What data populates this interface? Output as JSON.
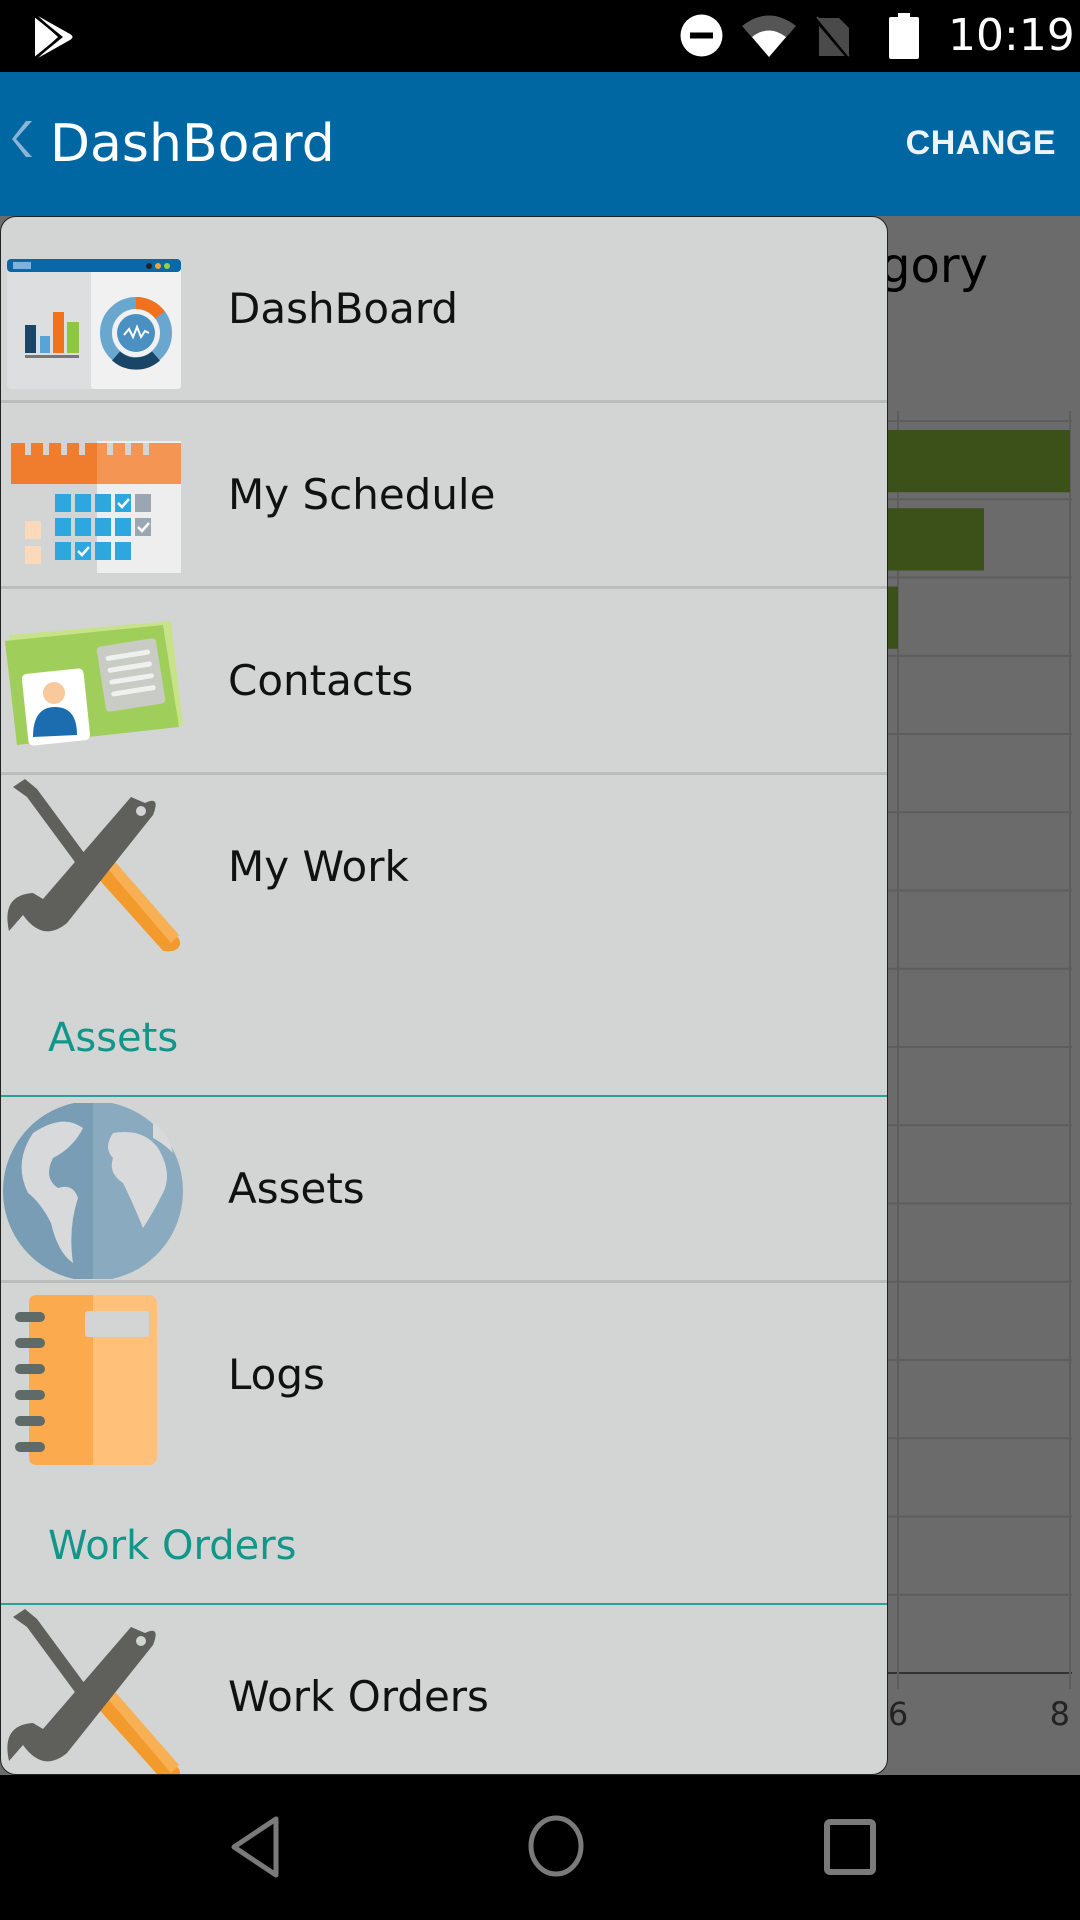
{
  "status_bar": {
    "time": "10:19",
    "icons": [
      "play-store-icon",
      "do-not-disturb-icon",
      "wifi-icon",
      "no-sim-icon",
      "battery-icon"
    ]
  },
  "app_bar": {
    "back_icon": "chevron-left-icon",
    "title": "DashBoard",
    "action_label": "CHANGE",
    "background_color": "#0167a3"
  },
  "background_content": {
    "title_visible_fragment": "gory",
    "chart_data": {
      "type": "bar",
      "orientation": "horizontal",
      "title": "gory",
      "series": [
        {
          "name": "",
          "values": [
            8,
            7,
            6
          ],
          "color": "#44552a"
        }
      ],
      "categories": [
        "",
        "",
        ""
      ],
      "visible_x_ticks": [
        "6",
        "8"
      ],
      "xlim": [
        6,
        8
      ],
      "grid": true,
      "row_count": 16
    }
  },
  "drawer": {
    "background_color": "#d3d5d5",
    "section_color": "#12968a",
    "groups": [
      {
        "header": null,
        "items": [
          {
            "label": "DashBoard",
            "icon": "dashboard-icon"
          },
          {
            "label": "My Schedule",
            "icon": "calendar-icon"
          },
          {
            "label": "Contacts",
            "icon": "contact-card-icon"
          },
          {
            "label": "My Work",
            "icon": "wrench-screwdriver-icon"
          }
        ]
      },
      {
        "header": "Assets",
        "items": [
          {
            "label": "Assets",
            "icon": "globe-icon"
          },
          {
            "label": "Logs",
            "icon": "notebook-icon"
          }
        ]
      },
      {
        "header": "Work Orders",
        "items": [
          {
            "label": "Work Orders",
            "icon": "wrench-screwdriver-icon"
          }
        ]
      }
    ]
  },
  "nav_bar": {
    "buttons": [
      "back",
      "home",
      "recents"
    ]
  }
}
